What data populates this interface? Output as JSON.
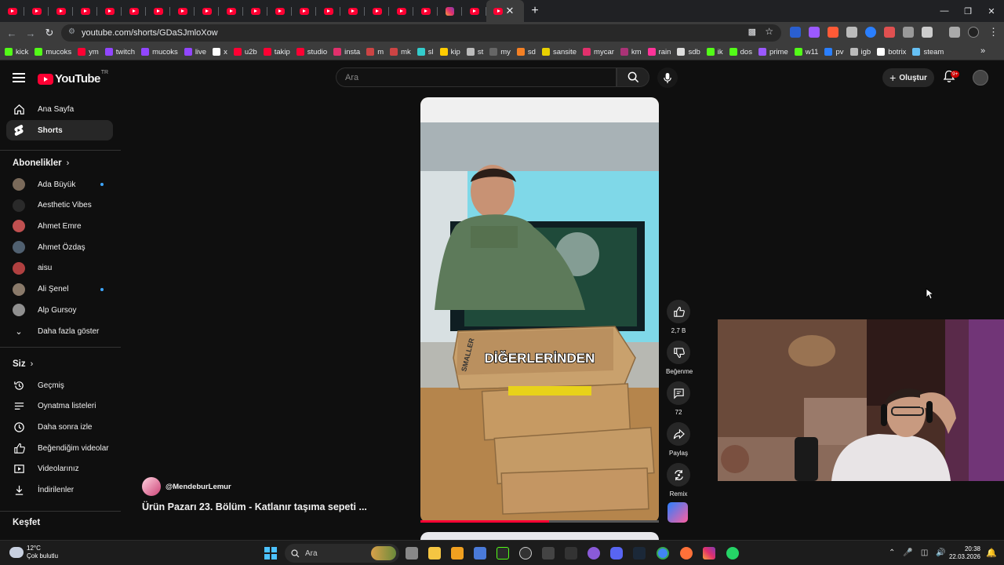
{
  "browser": {
    "url": "youtube.com/shorts/GDaSJmloXow",
    "tab_count_youtube": 20,
    "bookmarks": [
      {
        "label": "kick",
        "color": "#53fc18"
      },
      {
        "label": "mucoks",
        "color": "#53fc18"
      },
      {
        "label": "ym",
        "color": "#ff0033"
      },
      {
        "label": "twitch",
        "color": "#9146ff"
      },
      {
        "label": "mucoks",
        "color": "#9146ff"
      },
      {
        "label": "live",
        "color": "#9146ff"
      },
      {
        "label": "x",
        "color": "#ffffff"
      },
      {
        "label": "u2b",
        "color": "#ff0033"
      },
      {
        "label": "takip",
        "color": "#ff0033"
      },
      {
        "label": "studio",
        "color": "#ff0033"
      },
      {
        "label": "insta",
        "color": "#e1306c"
      },
      {
        "label": "m",
        "color": "#cc4444"
      },
      {
        "label": "mk",
        "color": "#cc4444"
      },
      {
        "label": "sl",
        "color": "#33cccc"
      },
      {
        "label": "kip",
        "color": "#ffcc00"
      },
      {
        "label": "st",
        "color": "#bbbbbb"
      },
      {
        "label": "my",
        "color": "#666666"
      },
      {
        "label": "sd",
        "color": "#f48024"
      },
      {
        "label": "sansite",
        "color": "#e8d000"
      },
      {
        "label": "mycar",
        "color": "#e1306c"
      },
      {
        "label": "km",
        "color": "#aa3377"
      },
      {
        "label": "rain",
        "color": "#ff3399"
      },
      {
        "label": "sdb",
        "color": "#dddddd"
      },
      {
        "label": "ik",
        "color": "#53fc18"
      },
      {
        "label": "dos",
        "color": "#53fc18"
      },
      {
        "label": "prime",
        "color": "#9b59ff"
      },
      {
        "label": "w11",
        "color": "#53fc18"
      },
      {
        "label": "pv",
        "color": "#2a7fff"
      },
      {
        "label": "igb",
        "color": "#bbbbbb"
      },
      {
        "label": "botrix",
        "color": "#ffffff"
      },
      {
        "label": "steam",
        "color": "#66c0f4"
      }
    ]
  },
  "header": {
    "logo_text": "YouTube",
    "logo_country": "TR",
    "search_placeholder": "Ara",
    "create_label": "Oluştur",
    "notif_badge": "9+"
  },
  "sidebar": {
    "main": [
      {
        "label": "Ana Sayfa",
        "icon": "home-icon"
      },
      {
        "label": "Shorts",
        "icon": "shorts-icon",
        "active": true
      }
    ],
    "subs_heading": "Abonelikler",
    "subs": [
      {
        "label": "Ada Büyük",
        "color": "#7a6a5a",
        "new": true
      },
      {
        "label": "Aesthetic Vibes",
        "color": "#2a2a2a",
        "new": false
      },
      {
        "label": "Ahmet Emre",
        "color": "#c05050",
        "new": false
      },
      {
        "label": "Ahmet Özdaş",
        "color": "#506070",
        "new": false
      },
      {
        "label": "aisu",
        "color": "#b04040",
        "new": false
      },
      {
        "label": "Ali Şenel",
        "color": "#8a7a6a",
        "new": true
      },
      {
        "label": "Alp Gursoy",
        "color": "#909090",
        "new": false
      }
    ],
    "show_more": "Daha fazla göster",
    "you_heading": "Siz",
    "you": [
      {
        "label": "Geçmiş",
        "icon": "history-icon"
      },
      {
        "label": "Oynatma listeleri",
        "icon": "playlist-icon"
      },
      {
        "label": "Daha sonra izle",
        "icon": "clock-icon"
      },
      {
        "label": "Beğendiğim videolar",
        "icon": "like-icon"
      },
      {
        "label": "Videolarınız",
        "icon": "video-icon"
      },
      {
        "label": "İndirilenler",
        "icon": "download-icon"
      }
    ],
    "explore_heading": "Keşfet"
  },
  "short": {
    "channel": "@MendeburLemur",
    "title": "Ürün Pazarı 23. Bölüm - Katlanır taşıma sepeti ...",
    "caption": "DİĞERLERİNDEN",
    "box_label": "SMALLER",
    "progress": 0.54,
    "actions": {
      "likes": "2,7 B",
      "dislike": "Beğenme",
      "comments": "72",
      "share": "Paylaş",
      "remix": "Remix"
    }
  },
  "taskbar": {
    "temp": "12°C",
    "weather": "Çok bulutlu",
    "search": "Ara",
    "time": "20:38",
    "date": "22.03.2026"
  }
}
